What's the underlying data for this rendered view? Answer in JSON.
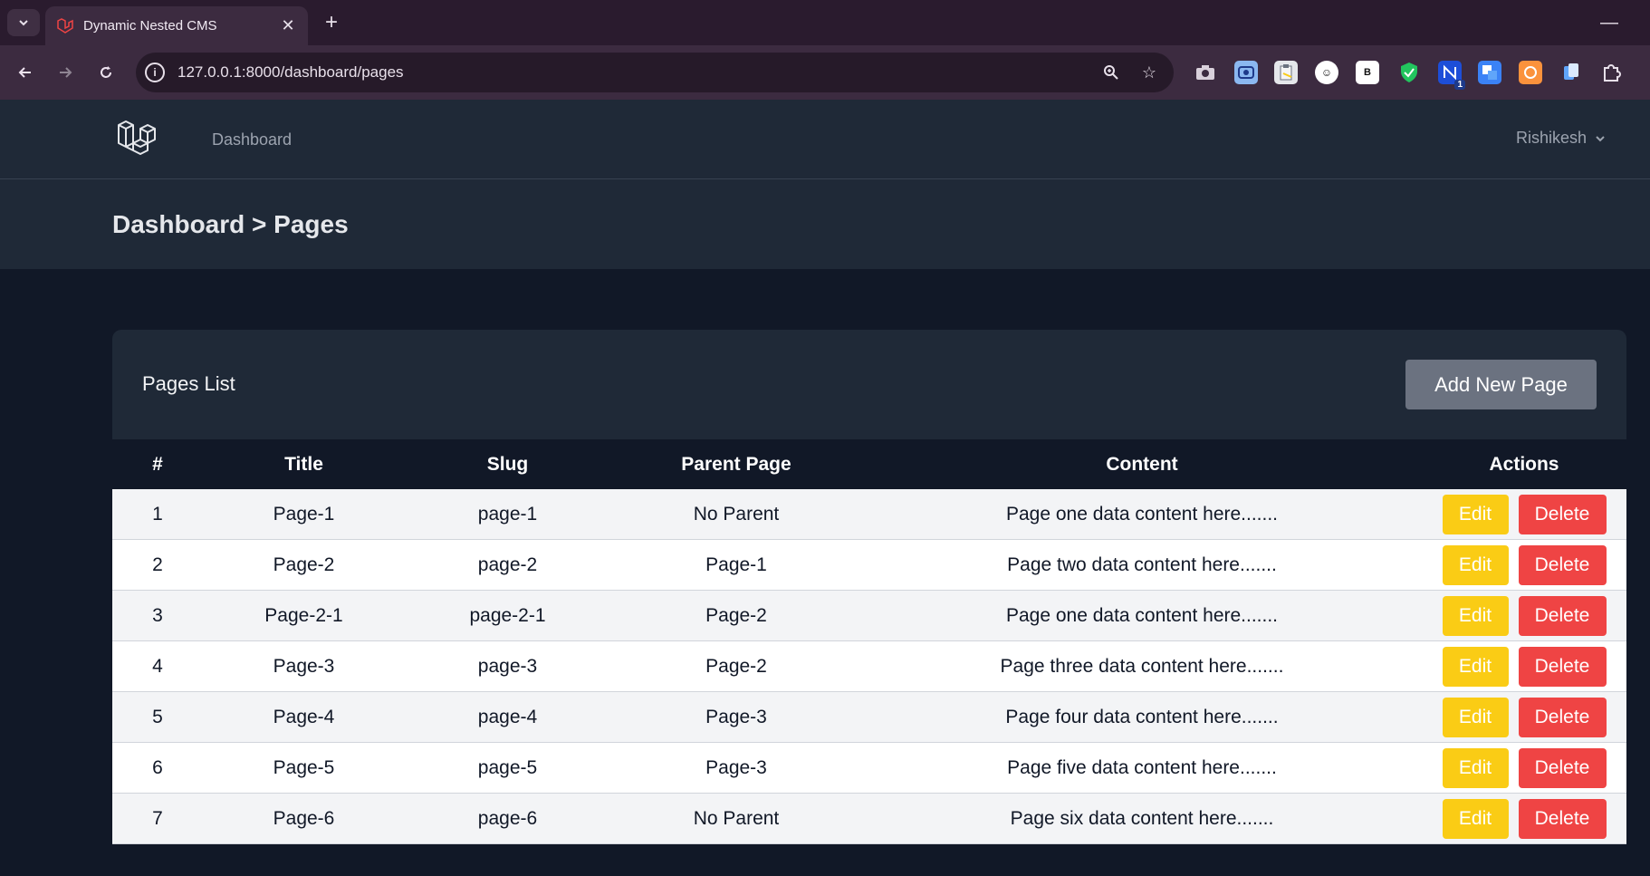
{
  "browser": {
    "tab_title": "Dynamic Nested CMS",
    "url": "127.0.0.1:8000/dashboard/pages",
    "extensions": [
      "camera-icon",
      "screen-capture-icon",
      "clipboard-icon",
      "face-icon",
      "b-ext-icon",
      "shield-icon",
      "n-ext-icon",
      "translate-icon",
      "orange-ext-icon",
      "copy-icon",
      "puzzle-icon"
    ],
    "extension_badge": "1",
    "ext_b_label": "B"
  },
  "nav": {
    "dashboard_link": "Dashboard",
    "user_name": "Rishikesh"
  },
  "header": {
    "breadcrumb": "Dashboard > Pages"
  },
  "card": {
    "title": "Pages List",
    "add_button": "Add New Page"
  },
  "table": {
    "columns": [
      "#",
      "Title",
      "Slug",
      "Parent Page",
      "Content",
      "Actions"
    ],
    "rows": [
      {
        "id": "1",
        "title": "Page-1",
        "slug": "page-1",
        "parent": "No Parent",
        "content": "Page one data content here......."
      },
      {
        "id": "2",
        "title": "Page-2",
        "slug": "page-2",
        "parent": "Page-1",
        "content": "Page two data content here......."
      },
      {
        "id": "3",
        "title": "Page-2-1",
        "slug": "page-2-1",
        "parent": "Page-2",
        "content": "Page one data content here......."
      },
      {
        "id": "4",
        "title": "Page-3",
        "slug": "page-3",
        "parent": "Page-2",
        "content": "Page three data content here......."
      },
      {
        "id": "5",
        "title": "Page-4",
        "slug": "page-4",
        "parent": "Page-3",
        "content": "Page four data content here......."
      },
      {
        "id": "6",
        "title": "Page-5",
        "slug": "page-5",
        "parent": "Page-3",
        "content": "Page five data content here......."
      },
      {
        "id": "7",
        "title": "Page-6",
        "slug": "page-6",
        "parent": "No Parent",
        "content": "Page six data content here......."
      }
    ],
    "edit_label": "Edit",
    "delete_label": "Delete"
  },
  "colors": {
    "edit": "#facc15",
    "delete": "#ef4444",
    "add": "#6b7280",
    "nav_bg": "#1f2937",
    "page_bg": "#111827"
  }
}
